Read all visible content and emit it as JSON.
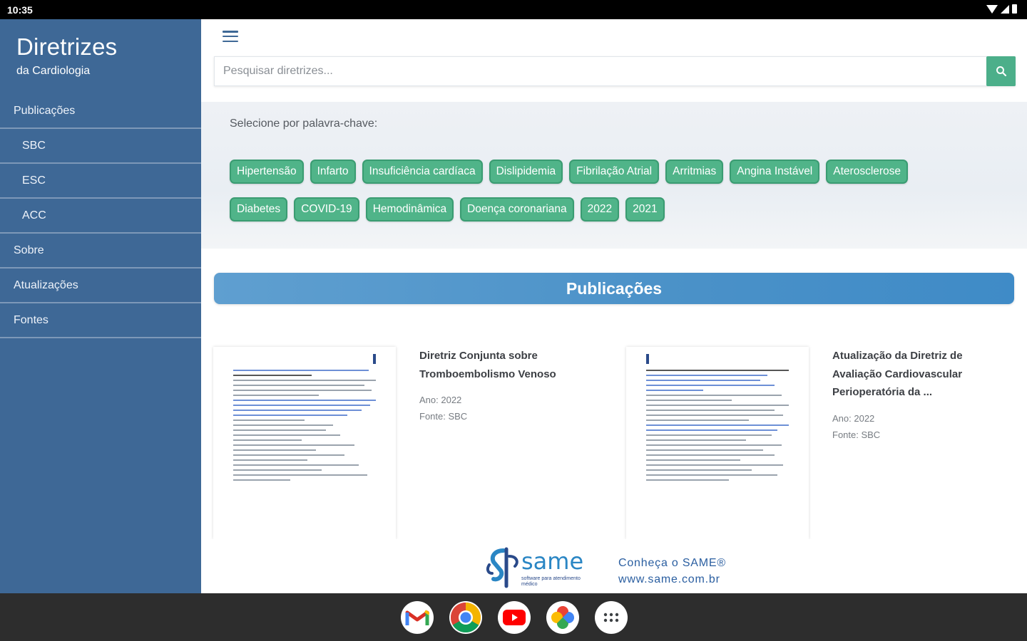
{
  "status_bar": {
    "time": "10:35"
  },
  "sidebar": {
    "title": "Diretrizes",
    "subtitle": "da Cardiologia",
    "items": [
      {
        "label": "Publicações",
        "level": "top"
      },
      {
        "label": "SBC",
        "level": "sub"
      },
      {
        "label": "ESC",
        "level": "sub"
      },
      {
        "label": "ACC",
        "level": "sub"
      },
      {
        "label": "Sobre",
        "level": "top"
      },
      {
        "label": "Atualizações",
        "level": "top"
      },
      {
        "label": "Fontes",
        "level": "top"
      }
    ]
  },
  "search": {
    "placeholder": "Pesquisar diretrizes..."
  },
  "keywords": {
    "label": "Selecione por palavra-chave:",
    "rows": [
      [
        "Hipertensão",
        "Infarto",
        "Insuficiência cardíaca",
        "Dislipidemia",
        "Fibrilação Atrial",
        "Arritmias",
        "Angina Instável",
        "Aterosclerose"
      ],
      [
        "Diabetes",
        "COVID-19",
        "Hemodinâmica",
        "Doença coronariana",
        "2022",
        "2021"
      ]
    ]
  },
  "publications": {
    "header": "Publicações",
    "items": [
      {
        "title": "Diretriz Conjunta sobre Tromboembolismo Venoso",
        "year": "Ano: 2022",
        "source": "Fonte: SBC"
      },
      {
        "title": "Atualização da Diretriz de Avaliação Cardiovascular Perioperatória da ...",
        "year": "Ano: 2022",
        "source": "Fonte: SBC"
      }
    ]
  },
  "footer": {
    "brand": "same",
    "brand_tagline": "software para atendimento médico",
    "cta_line1": "Conheça o SAME®",
    "cta_line2": "www.same.com.br"
  },
  "colors": {
    "sidebar": "#3e6896",
    "chip": "#50b489",
    "search_button": "#4caf8a",
    "publications_bar": "#4a91c8"
  },
  "dock": [
    {
      "name": "gmail-icon"
    },
    {
      "name": "chrome-icon"
    },
    {
      "name": "youtube-icon"
    },
    {
      "name": "photos-icon"
    },
    {
      "name": "app-drawer-icon"
    }
  ]
}
